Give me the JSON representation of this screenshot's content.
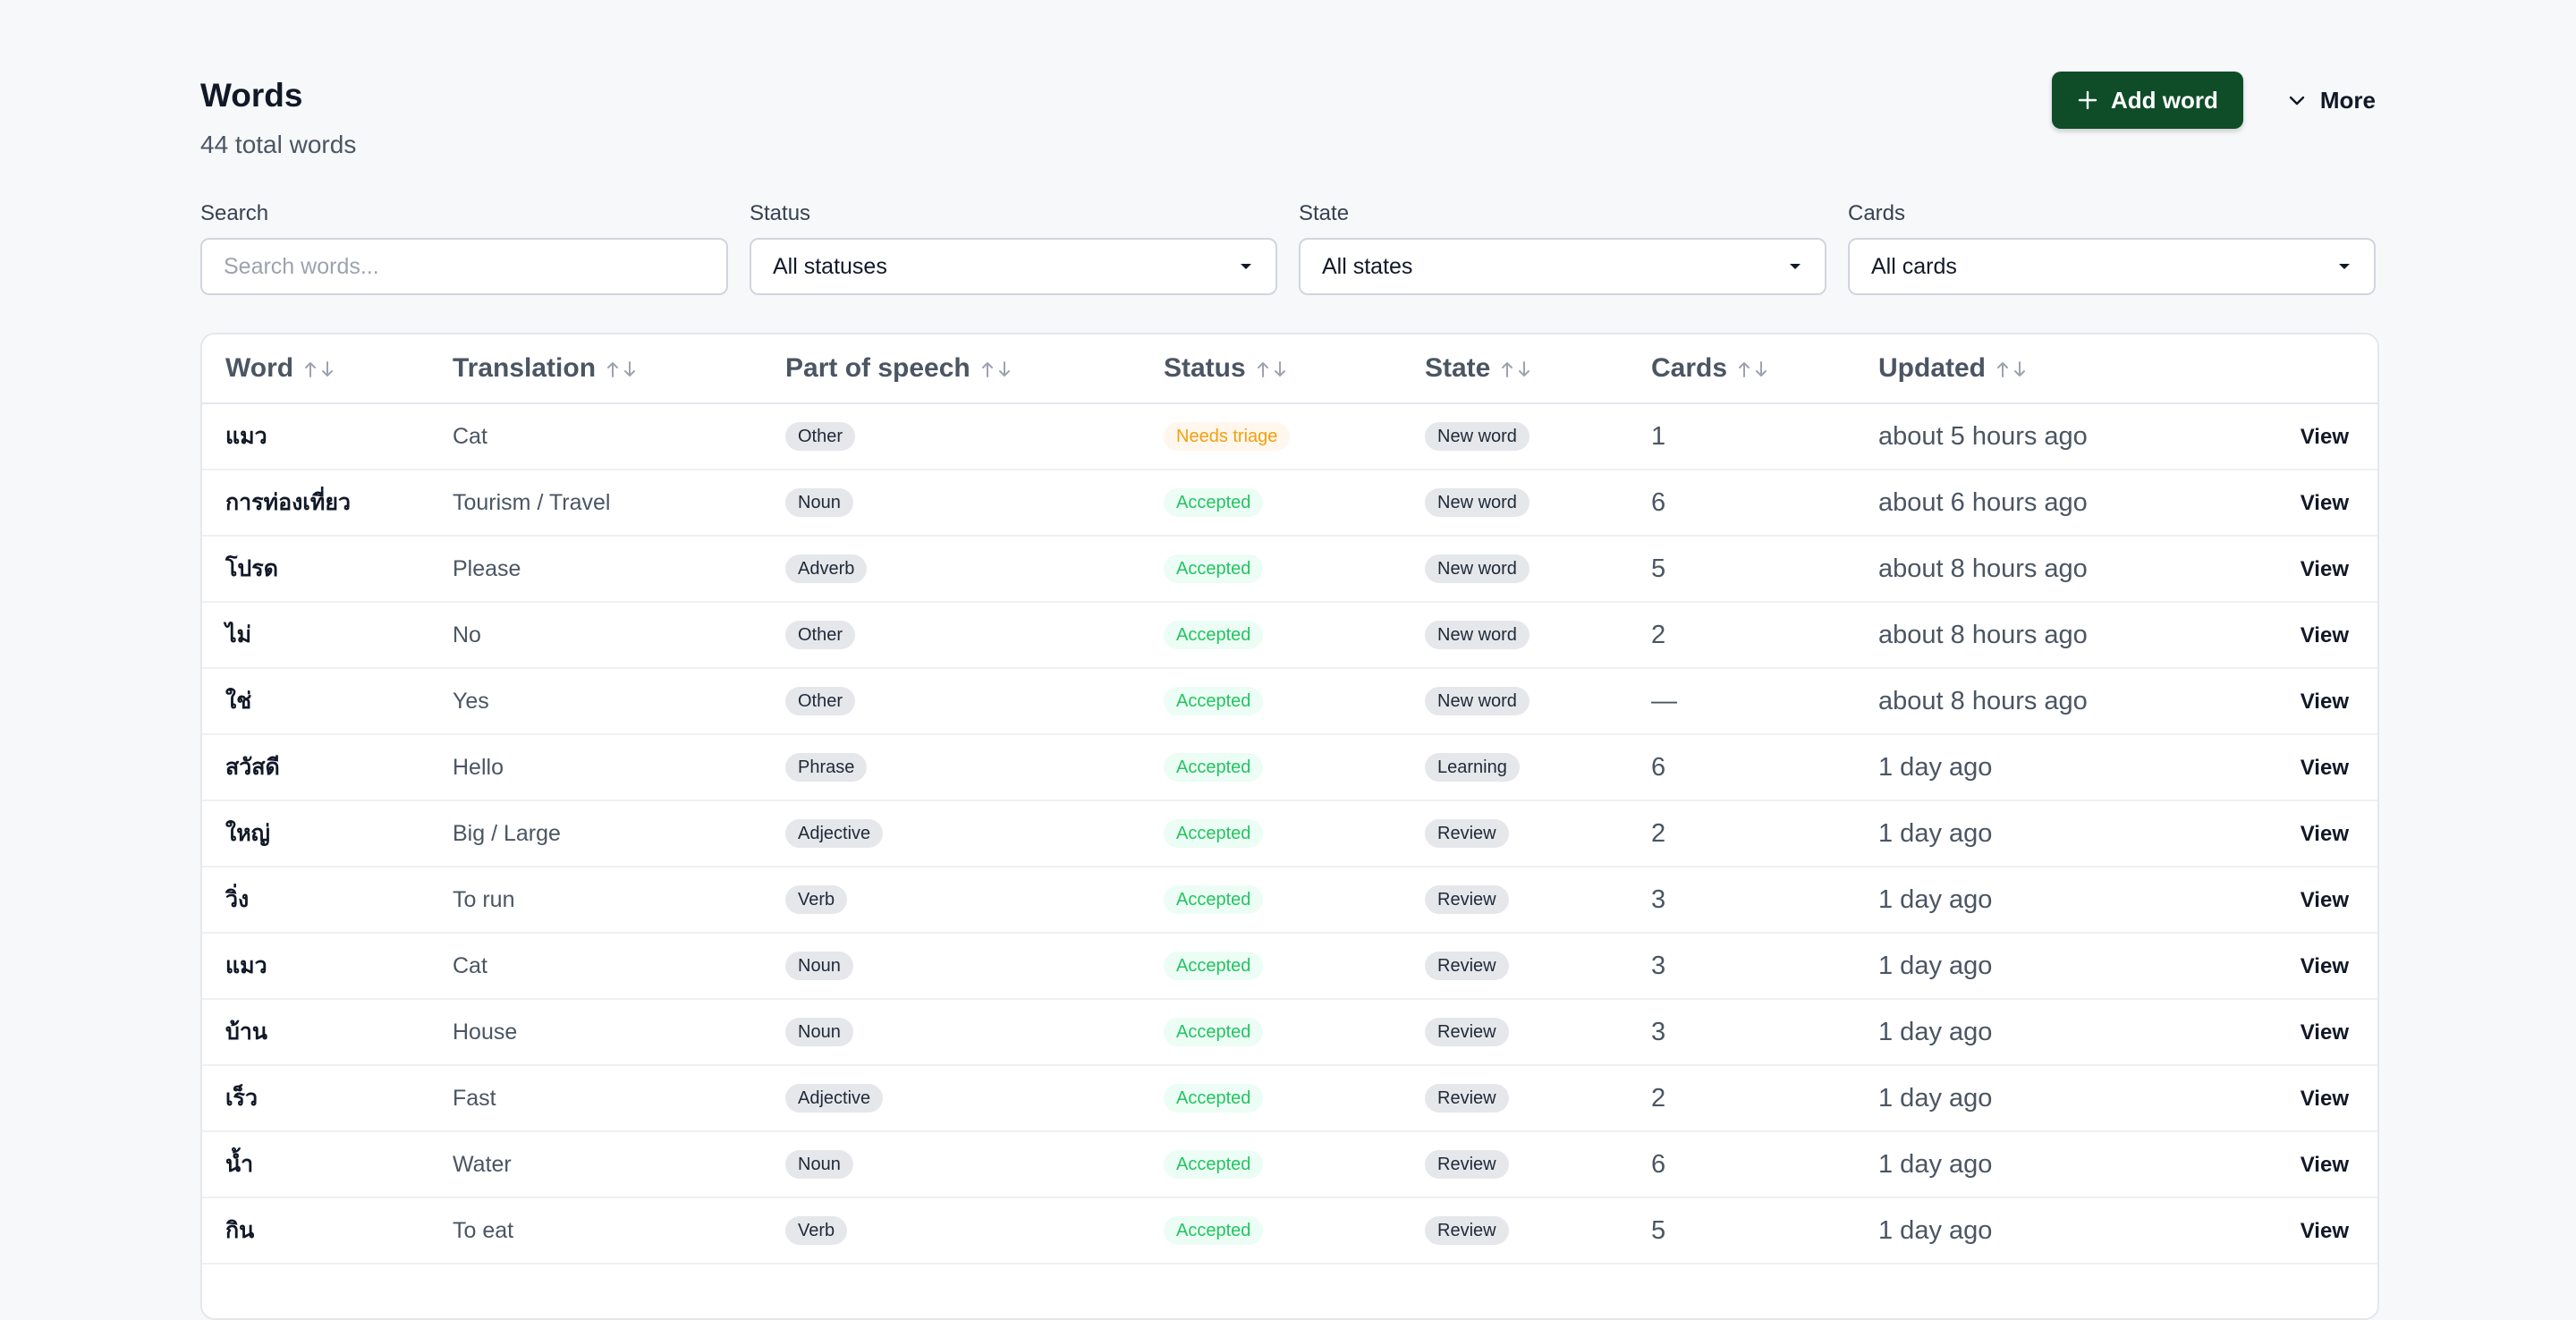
{
  "header": {
    "title": "Words",
    "subtitle": "44 total words"
  },
  "actions": {
    "add_label": "Add word",
    "more_label": "More"
  },
  "filters": {
    "search_label": "Search",
    "search_placeholder": "Search words...",
    "status_label": "Status",
    "status_value": "All statuses",
    "state_label": "State",
    "state_value": "All states",
    "cards_label": "Cards",
    "cards_value": "All cards"
  },
  "table": {
    "columns": [
      "Word",
      "Translation",
      "Part of speech",
      "Status",
      "State",
      "Cards",
      "Updated"
    ],
    "view_label": "View",
    "rows": [
      {
        "word": "แมว",
        "translation": "Cat",
        "pos": "Other",
        "status": "Needs triage",
        "state": "New word",
        "cards": "1",
        "updated": "about 5 hours ago"
      },
      {
        "word": "การท่องเที่ยว",
        "translation": "Tourism / Travel",
        "pos": "Noun",
        "status": "Accepted",
        "state": "New word",
        "cards": "6",
        "updated": "about 6 hours ago"
      },
      {
        "word": "โปรด",
        "translation": "Please",
        "pos": "Adverb",
        "status": "Accepted",
        "state": "New word",
        "cards": "5",
        "updated": "about 8 hours ago"
      },
      {
        "word": "ไม่",
        "translation": "No",
        "pos": "Other",
        "status": "Accepted",
        "state": "New word",
        "cards": "2",
        "updated": "about 8 hours ago"
      },
      {
        "word": "ใช่",
        "translation": "Yes",
        "pos": "Other",
        "status": "Accepted",
        "state": "New word",
        "cards": "—",
        "updated": "about 8 hours ago"
      },
      {
        "word": "สวัสดี",
        "translation": "Hello",
        "pos": "Phrase",
        "status": "Accepted",
        "state": "Learning",
        "cards": "6",
        "updated": "1 day ago"
      },
      {
        "word": "ใหญ่",
        "translation": "Big / Large",
        "pos": "Adjective",
        "status": "Accepted",
        "state": "Review",
        "cards": "2",
        "updated": "1 day ago"
      },
      {
        "word": "วิ่ง",
        "translation": "To run",
        "pos": "Verb",
        "status": "Accepted",
        "state": "Review",
        "cards": "3",
        "updated": "1 day ago"
      },
      {
        "word": "แมว",
        "translation": "Cat",
        "pos": "Noun",
        "status": "Accepted",
        "state": "Review",
        "cards": "3",
        "updated": "1 day ago"
      },
      {
        "word": "บ้าน",
        "translation": "House",
        "pos": "Noun",
        "status": "Accepted",
        "state": "Review",
        "cards": "3",
        "updated": "1 day ago"
      },
      {
        "word": "เร็ว",
        "translation": "Fast",
        "pos": "Adjective",
        "status": "Accepted",
        "state": "Review",
        "cards": "2",
        "updated": "1 day ago"
      },
      {
        "word": "น้ำ",
        "translation": "Water",
        "pos": "Noun",
        "status": "Accepted",
        "state": "Review",
        "cards": "6",
        "updated": "1 day ago"
      },
      {
        "word": "กิน",
        "translation": "To eat",
        "pos": "Verb",
        "status": "Accepted",
        "state": "Review",
        "cards": "5",
        "updated": "1 day ago"
      }
    ]
  },
  "colors": {
    "primary": "#0f4d28",
    "accepted": "#22c55e",
    "triage": "#f59e0b",
    "background": "#f6f8fa"
  },
  "icons": {
    "add": "plus-icon",
    "more": "chevron-down-icon",
    "select": "caret-down-icon",
    "sort": "sort-arrows-icon"
  }
}
